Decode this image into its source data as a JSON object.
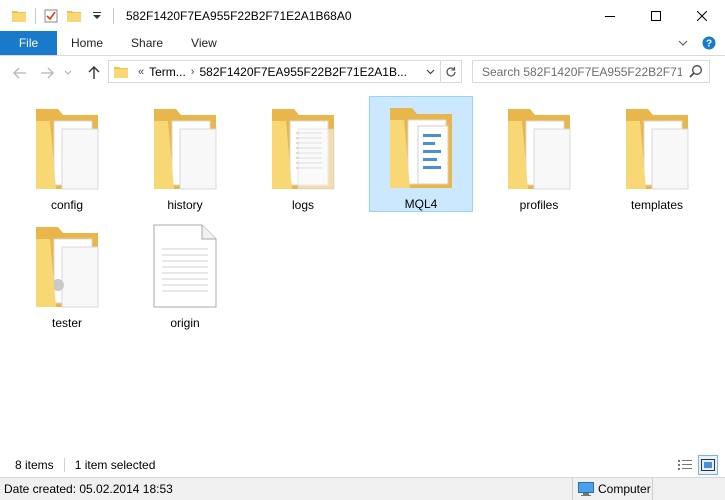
{
  "window": {
    "title": "582F1420F7EA955F22B2F71E2A1B68A0"
  },
  "ribbon": {
    "tabs": [
      {
        "label": "File"
      },
      {
        "label": "Home"
      },
      {
        "label": "Share"
      },
      {
        "label": "View"
      }
    ]
  },
  "address": {
    "overflow": "«",
    "crumbs": [
      "Term...",
      "582F1420F7EA955F22B2F71E2A1B..."
    ]
  },
  "search": {
    "placeholder": "Search 582F1420F7EA955F22B2F71E2..."
  },
  "items": [
    {
      "label": "config",
      "type": "folder",
      "icon": "folder-with-documents-icon",
      "selected": false
    },
    {
      "label": "history",
      "type": "folder",
      "icon": "folder-with-documents-icon",
      "selected": false
    },
    {
      "label": "logs",
      "type": "folder",
      "icon": "folder-with-documents-icon",
      "selected": false
    },
    {
      "label": "MQL4",
      "type": "folder",
      "icon": "folder-with-documents-icon",
      "selected": true
    },
    {
      "label": "profiles",
      "type": "folder",
      "icon": "folder-with-documents-icon",
      "selected": false
    },
    {
      "label": "templates",
      "type": "folder",
      "icon": "folder-with-documents-icon",
      "selected": false
    },
    {
      "label": "tester",
      "type": "folder",
      "icon": "folder-with-documents-icon",
      "selected": false
    },
    {
      "label": "origin",
      "type": "file",
      "icon": "file-icon",
      "selected": false
    }
  ],
  "status": {
    "count": "8 items",
    "selection": "1 item selected"
  },
  "details": {
    "text": "Date created: 05.02.2014 18:53",
    "location": "Computer"
  },
  "colors": {
    "accent": "#1979ca",
    "selection_bg": "#cce8ff",
    "selection_border": "#99d1ff",
    "folder": "#f8d775"
  }
}
